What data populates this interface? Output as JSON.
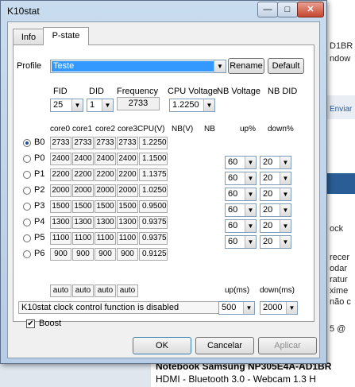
{
  "background": {
    "right_text": [
      "D1BR",
      "ndow",
      "Enviar",
      "ock",
      "recer",
      "odar",
      "ratur",
      "xime",
      "não c",
      "5 @"
    ],
    "bottom_line1": "Notebook Samsung NP305E4A-AD1BR",
    "bottom_line2": "HDMI - Bluetooth 3.0 - Webcam 1.3 H"
  },
  "window": {
    "title": "K10stat",
    "minimize": "—",
    "maximize": "□",
    "close": "✕"
  },
  "tabs": [
    {
      "label": "Info"
    },
    {
      "label": "P-state"
    }
  ],
  "profile": {
    "label": "Profile",
    "value": "Teste",
    "rename": "Rename",
    "default": "Default"
  },
  "header": {
    "fid": "FID",
    "did": "DID",
    "frequency": "Frequency",
    "cpu_voltage": "CPU Voltage",
    "nb_voltage": "NB Voltage",
    "nb_did": "NB DID",
    "fid_value": "25",
    "did_value": "1",
    "frequency_value": "2733",
    "cpu_voltage_value": "1.2250"
  },
  "columns": {
    "core0": "core0",
    "core1": "core1",
    "core2": "core2",
    "core3": "core3",
    "cpuv": "CPU(V)",
    "nbv": "NB(V)",
    "nb": "NB",
    "up": "up%",
    "down": "down%"
  },
  "states": [
    {
      "name": "B0",
      "c0": "2733",
      "c1": "2733",
      "c2": "2733",
      "c3": "2733",
      "v": "1.2250",
      "selected": true
    },
    {
      "name": "P0",
      "c0": "2400",
      "c1": "2400",
      "c2": "2400",
      "c3": "2400",
      "v": "1.1500"
    },
    {
      "name": "P1",
      "c0": "2200",
      "c1": "2200",
      "c2": "2200",
      "c3": "2200",
      "v": "1.1375"
    },
    {
      "name": "P2",
      "c0": "2000",
      "c1": "2000",
      "c2": "2000",
      "c3": "2000",
      "v": "1.0250"
    },
    {
      "name": "P3",
      "c0": "1500",
      "c1": "1500",
      "c2": "1500",
      "c3": "1500",
      "v": "0.9500"
    },
    {
      "name": "P4",
      "c0": "1300",
      "c1": "1300",
      "c2": "1300",
      "c3": "1300",
      "v": "0.9375"
    },
    {
      "name": "P5",
      "c0": "1100",
      "c1": "1100",
      "c2": "1100",
      "c3": "1100",
      "v": "0.9375"
    },
    {
      "name": "P6",
      "c0": "900",
      "c1": "900",
      "c2": "900",
      "c3": "900",
      "v": "0.9125"
    }
  ],
  "thresholds": [
    {
      "up": "60",
      "down": "20"
    },
    {
      "up": "60",
      "down": "20"
    },
    {
      "up": "60",
      "down": "20"
    },
    {
      "up": "60",
      "down": "20"
    },
    {
      "up": "60",
      "down": "20"
    },
    {
      "up": "60",
      "down": "20"
    }
  ],
  "auto": [
    "auto",
    "auto",
    "auto",
    "auto"
  ],
  "timing": {
    "up_label": "up(ms)",
    "down_label": "down(ms)",
    "up_value": "500",
    "down_value": "2000"
  },
  "status": "K10stat clock control function is disabled",
  "boost": {
    "label": "Boost",
    "checked": true,
    "mark": "✔"
  },
  "buttons": {
    "ok": "OK",
    "cancel": "Cancelar",
    "apply": "Aplicar"
  },
  "arrow_glyph": "▼"
}
